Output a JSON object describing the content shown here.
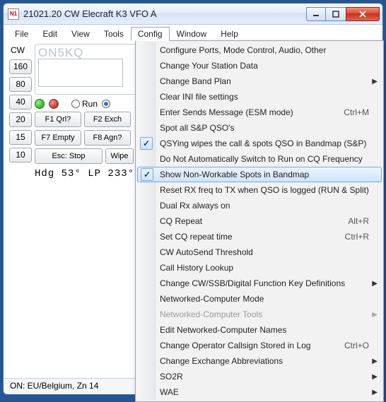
{
  "titlebar": {
    "app_icon_text": "N1",
    "title": "21021.20 CW Elecraft K3 VFO A"
  },
  "menubar": {
    "items": [
      "File",
      "Edit",
      "View",
      "Tools",
      "Config",
      "Window",
      "Help"
    ],
    "open_index": 4
  },
  "bands": {
    "cw_label": "CW",
    "buttons": [
      "160",
      "80",
      "40",
      "20",
      "15",
      "10"
    ]
  },
  "callsign": {
    "hint": "ON5KQ",
    "value": ""
  },
  "run_sp": {
    "run_label": "Run",
    "run_checked": false,
    "sp_checked": true
  },
  "fkeys": {
    "row1": [
      "F1 Qrl?",
      "F2 Exch"
    ],
    "row2": [
      "F7 Empty",
      "F8 Agn?"
    ]
  },
  "esc_row": {
    "esc": "Esc: Stop",
    "wipe": "Wipe"
  },
  "heading": "Hdg  53°  LP  233°",
  "statusbar": "ON: EU/Belgium, Zn 14",
  "config_menu": {
    "items": [
      {
        "label": "Configure Ports, Mode Control, Audio, Other"
      },
      {
        "label": "Change Your Station Data"
      },
      {
        "label": "Change Band Plan",
        "submenu": true
      },
      {
        "label": "Clear INI file settings"
      },
      {
        "label": "Enter Sends Message (ESM mode)",
        "shortcut": "Ctrl+M"
      },
      {
        "label": "Spot all S&P QSO's"
      },
      {
        "label": "QSYing wipes the call & spots QSO in Bandmap (S&P)",
        "checked": true
      },
      {
        "label": "Do Not Automatically Switch to Run on CQ Frequency"
      },
      {
        "label": "Show Non-Workable Spots in Bandmap",
        "checked": true,
        "highlight": true
      },
      {
        "label": "Reset RX freq to TX when QSO is logged (RUN & Split)"
      },
      {
        "label": "Dual Rx always on"
      },
      {
        "label": "CQ Repeat",
        "shortcut": "Alt+R"
      },
      {
        "label": "Set CQ repeat time",
        "shortcut": "Ctrl+R"
      },
      {
        "label": "CW AutoSend Threshold"
      },
      {
        "label": "Call History Lookup"
      },
      {
        "label": "Change CW/SSB/Digital Function Key Definitions",
        "submenu": true
      },
      {
        "label": "Networked-Computer Mode"
      },
      {
        "label": "Networked-Computer Tools",
        "submenu": true,
        "disabled": true
      },
      {
        "label": "Edit Networked-Computer Names"
      },
      {
        "label": "Change Operator Callsign Stored in Log",
        "shortcut": "Ctrl+O"
      },
      {
        "label": "Change Exchange Abbreviations",
        "submenu": true
      },
      {
        "label": "SO2R",
        "submenu": true
      },
      {
        "label": "WAE",
        "submenu": true
      }
    ]
  }
}
